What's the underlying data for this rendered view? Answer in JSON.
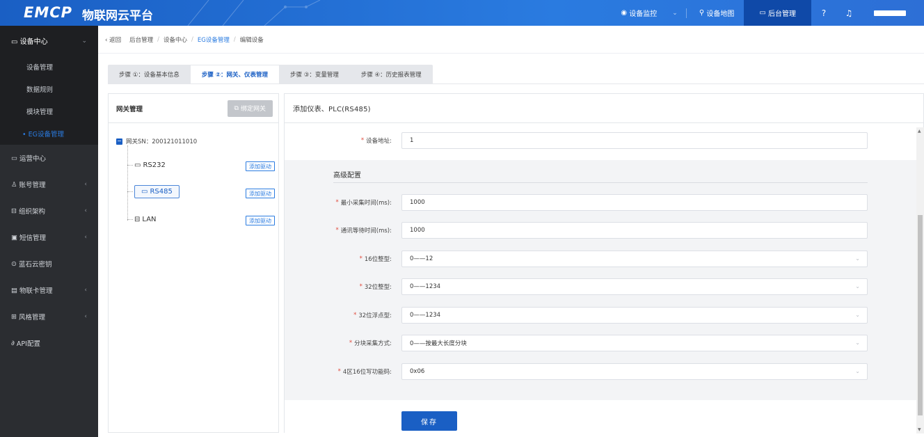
{
  "app": {
    "logo": "EMCP",
    "title": "物联网云平台"
  },
  "topnav": {
    "monitor": "设备监控",
    "map": "设备地图",
    "admin": "后台管理"
  },
  "sidebar": {
    "group": "设备中心",
    "subitems": [
      "设备管理",
      "数据规则",
      "模块管理",
      "• EG设备管理"
    ],
    "items": [
      "运营中心",
      "账号管理",
      "组织架构",
      "短信管理",
      "蓝石云密钥",
      "物联卡管理",
      "风格管理",
      "API配置"
    ]
  },
  "breadcrumb": {
    "back": "返回",
    "items": [
      "后台管理",
      "设备中心",
      "EG设备管理",
      "编辑设备"
    ]
  },
  "tabs": [
    "步骤 ①：设备基本信息",
    "步骤 ②：网关、仪表管理",
    "步骤 ③：变量管理",
    "步骤 ④：历史报表管理"
  ],
  "gateway_panel": {
    "title": "网关管理",
    "bind_button": "绑定网关",
    "root": "网关SN：200121011010",
    "nodes": [
      "RS232",
      "RS485",
      "LAN"
    ],
    "add_driver": "添加驱动"
  },
  "form_panel": {
    "title": "添加仪表、PLC(RS485)",
    "device_address": {
      "label": "设备地址:",
      "value": "1"
    },
    "advanced_title": "高级配置",
    "fields": [
      {
        "label": "最小采集时间(ms):",
        "value": "1000",
        "dropdown": false
      },
      {
        "label": "通讯等待时间(ms):",
        "value": "1000",
        "dropdown": false
      },
      {
        "label": "16位整型:",
        "value": "0——12",
        "dropdown": true
      },
      {
        "label": "32位整型:",
        "value": "0——1234",
        "dropdown": true
      },
      {
        "label": "32位浮点型:",
        "value": "0——1234",
        "dropdown": true
      },
      {
        "label": "分块采集方式:",
        "value": "0——按最大长度分块",
        "dropdown": true
      },
      {
        "label": "4区16位写功能码:",
        "value": "0x06",
        "dropdown": true
      }
    ],
    "save": "保存"
  }
}
